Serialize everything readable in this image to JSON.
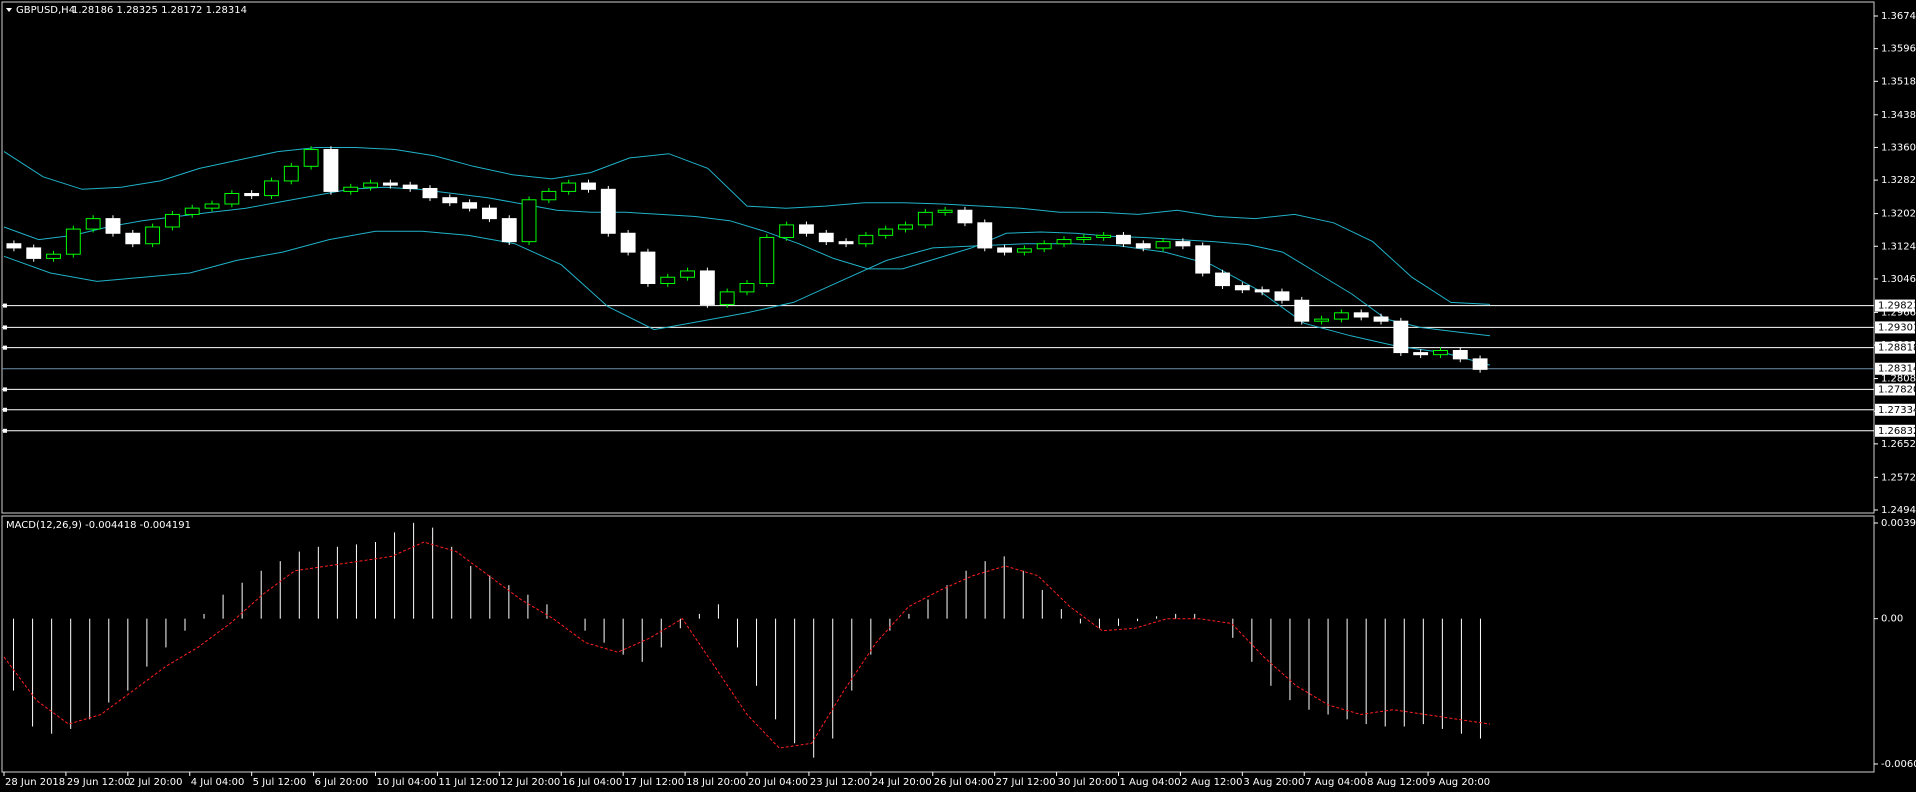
{
  "header": {
    "symbol": "GBPUSD,H4",
    "ohlc": "1.28186 1.28325 1.28172 1.28314"
  },
  "macd_header": "MACD(12,26,9) -0.004418 -0.004191",
  "colors": {
    "bull_candle": "#00ff00",
    "bear_candle": "#ffffff",
    "bollinger": "#20b2c8",
    "macd_signal": "#ff2020",
    "macd_hist": "#ffffff",
    "horizontal_lines": "#ffffff",
    "bid_line": "#6a8fa8"
  },
  "chart_data": [
    {
      "type": "line",
      "name": "price",
      "price_axis_ticks": [
        "1.36740",
        "1.35960",
        "1.35180",
        "1.34380",
        "1.33600",
        "1.32820",
        "1.32020",
        "1.31240",
        "1.30460",
        "1.29660",
        "1.28880",
        "1.28080",
        "1.27300",
        "1.26520",
        "1.25720",
        "1.24940"
      ],
      "ylim": [
        1.2494,
        1.3674
      ],
      "horizontal_line_labels": [
        "1.29823",
        "1.29301",
        "1.28818",
        "1.27820",
        "1.27334",
        "1.26832"
      ],
      "current_price_label": "1.28314",
      "time_labels": [
        "28 Jun 2018",
        "29 Jun 12:00",
        "2 Jul 20:00",
        "4 Jul 04:00",
        "5 Jul 12:00",
        "6 Jul 20:00",
        "10 Jul 04:00",
        "11 Jul 12:00",
        "12 Jul 20:00",
        "16 Jul 04:00",
        "17 Jul 12:00",
        "18 Jul 20:00",
        "20 Jul 04:00",
        "23 Jul 12:00",
        "24 Jul 20:00",
        "26 Jul 04:00",
        "27 Jul 12:00",
        "30 Jul 20:00",
        "1 Aug 04:00",
        "2 Aug 12:00",
        "3 Aug 20:00",
        "7 Aug 04:00",
        "8 Aug 12:00",
        "9 Aug 20:00"
      ],
      "close_path": [
        1.312,
        1.3095,
        1.3105,
        1.3165,
        1.319,
        1.3155,
        1.313,
        1.317,
        1.32,
        1.3215,
        1.3225,
        1.325,
        1.3245,
        1.328,
        1.3315,
        1.3355,
        1.3255,
        1.3265,
        1.3275,
        1.327,
        1.3262,
        1.324,
        1.3228,
        1.3215,
        1.319,
        1.3135,
        1.3235,
        1.3255,
        1.3275,
        1.326,
        1.3155,
        1.311,
        1.3035,
        1.305,
        1.3065,
        1.2985,
        1.3015,
        1.3035,
        1.3145,
        1.3175,
        1.3155,
        1.3135,
        1.313,
        1.315,
        1.3165,
        1.3175,
        1.3205,
        1.321,
        1.318,
        1.312,
        1.311,
        1.3118,
        1.313,
        1.314,
        1.3145,
        1.315,
        1.313,
        1.312,
        1.3135,
        1.3125,
        1.306,
        1.303,
        1.302,
        1.3015,
        1.2995,
        1.2945,
        1.295,
        1.2965,
        1.2955,
        1.2945,
        1.287,
        1.2865,
        1.2875,
        1.2855,
        1.283
      ],
      "bollinger_mid": [
        1.317,
        1.314,
        1.315,
        1.317,
        1.3185,
        1.3195,
        1.3205,
        1.3215,
        1.323,
        1.3245,
        1.326,
        1.3265,
        1.326,
        1.325,
        1.324,
        1.3225,
        1.321,
        1.3205,
        1.3205,
        1.32,
        1.3195,
        1.3185,
        1.316,
        1.313,
        1.3095,
        1.307,
        1.307,
        1.3095,
        1.312,
        1.3155,
        1.3158,
        1.3155,
        1.3148,
        1.3145,
        1.314,
        1.3135,
        1.3128,
        1.311,
        1.306,
        1.301,
        1.295,
        1.293,
        1.292,
        1.291
      ],
      "bollinger_upper": [
        1.335,
        1.329,
        1.326,
        1.3265,
        1.328,
        1.331,
        1.333,
        1.335,
        1.336,
        1.336,
        1.3355,
        1.334,
        1.3315,
        1.3295,
        1.3285,
        1.33,
        1.3335,
        1.3345,
        1.331,
        1.322,
        1.3215,
        1.322,
        1.3228,
        1.3228,
        1.3225,
        1.322,
        1.3215,
        1.3205,
        1.3205,
        1.32,
        1.321,
        1.3195,
        1.319,
        1.32,
        1.318,
        1.3135,
        1.305,
        1.299,
        1.2985
      ],
      "bollinger_lower": [
        1.31,
        1.306,
        1.304,
        1.305,
        1.306,
        1.309,
        1.311,
        1.314,
        1.316,
        1.316,
        1.315,
        1.313,
        1.308,
        1.298,
        1.2925,
        1.2945,
        1.2965,
        1.299,
        1.304,
        1.309,
        1.312,
        1.3125,
        1.313,
        1.313,
        1.3125,
        1.311,
        1.308,
        1.302,
        1.294,
        1.291,
        1.2885,
        1.287,
        1.284
      ]
    },
    {
      "type": "bar",
      "name": "MACD(12,26,9)",
      "ylim": [
        -0.006064,
        0.003993
      ],
      "ticks": [
        "0.003993",
        "0.00",
        "-0.006064"
      ],
      "histogram": [
        -0.003,
        -0.0045,
        -0.0048,
        -0.0046,
        -0.0042,
        -0.0035,
        -0.003,
        -0.002,
        -0.0012,
        -0.0005,
        0.0002,
        0.001,
        0.0015,
        0.002,
        0.0024,
        0.0028,
        0.003,
        0.003,
        0.0031,
        0.0032,
        0.0036,
        0.004,
        0.0038,
        0.003,
        0.0022,
        0.0018,
        0.0014,
        0.001,
        0.0006,
        0.0,
        -0.0005,
        -0.001,
        -0.0015,
        -0.0018,
        -0.0012,
        -0.0004,
        0.0002,
        0.0006,
        -0.0012,
        -0.0028,
        -0.0042,
        -0.0052,
        -0.0058,
        -0.005,
        -0.003,
        -0.0015,
        -0.0005,
        0.0002,
        0.0008,
        0.0014,
        0.002,
        0.0024,
        0.0026,
        0.002,
        0.0012,
        0.0004,
        -0.0002,
        -0.0004,
        -0.0003,
        -0.0001,
        0.0001,
        0.0002,
        0.0002,
        0.0,
        -0.0008,
        -0.0018,
        -0.0028,
        -0.0034,
        -0.0038,
        -0.004,
        -0.0042,
        -0.0044,
        -0.0045,
        -0.0045,
        -0.0044,
        -0.0046,
        -0.0048,
        -0.005
      ],
      "signal": [
        -0.0016,
        -0.0034,
        -0.0044,
        -0.004,
        -0.003,
        -0.002,
        -0.0012,
        -0.0002,
        0.001,
        0.002,
        0.0022,
        0.0024,
        0.0026,
        0.0032,
        0.0028,
        0.0018,
        0.0008,
        0.0,
        -0.001,
        -0.0014,
        -0.0008,
        0.0,
        -0.002,
        -0.004,
        -0.0054,
        -0.0052,
        -0.003,
        -0.001,
        0.0005,
        0.0012,
        0.0018,
        0.0022,
        0.0018,
        0.0005,
        -0.0005,
        -0.0004,
        0.0,
        0.0,
        -0.0002,
        -0.0016,
        -0.0028,
        -0.0036,
        -0.004,
        -0.0038,
        -0.004,
        -0.0042,
        -0.0044
      ]
    }
  ]
}
